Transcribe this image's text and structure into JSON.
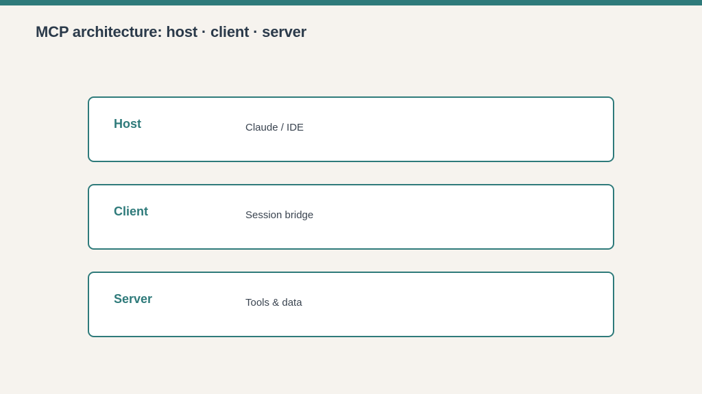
{
  "title": "MCP architecture: host · client · server",
  "colors": {
    "accent": "#2e7a7a",
    "background": "#f6f3ee",
    "card_background": "#ffffff",
    "title_text": "#2b3a4a",
    "body_text": "#3a4450"
  },
  "layers": [
    {
      "name": "Host",
      "description": "Claude / IDE"
    },
    {
      "name": "Client",
      "description": "Session bridge"
    },
    {
      "name": "Server",
      "description": "Tools & data"
    }
  ]
}
